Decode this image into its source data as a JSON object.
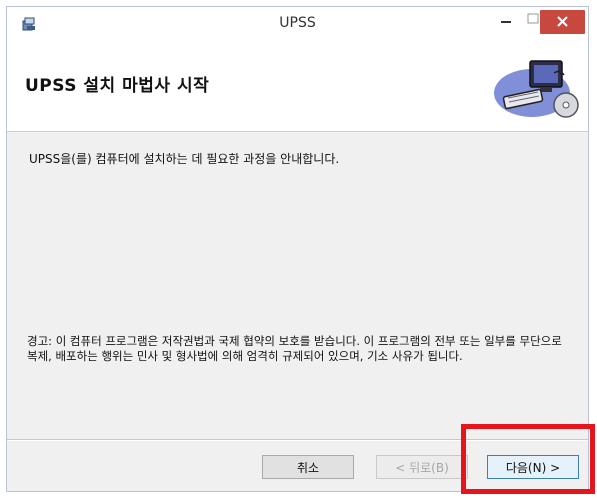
{
  "window": {
    "title": "UPSS",
    "controls": {
      "minimize": "–",
      "maximize": "□",
      "close": "✕"
    }
  },
  "header": {
    "title": "UPSS 설치 마법사 시작"
  },
  "content": {
    "description": "UPSS을(를) 컴퓨터에 설치하는 데 필요한 과정을 안내합니다.",
    "warning": "경고: 이 컴퓨터 프로그램은 저작권법과 국제 협약의 보호를 받습니다. 이 프로그램의 전부 또는 일부를 무단으로 복제, 배포하는 행위는 민사 및 형사법에 의해 엄격히 규제되어 있으며, 기소 사유가 됩니다."
  },
  "buttons": {
    "cancel": "취소",
    "back": "< 뒤로(B)",
    "next": "다음(N) >"
  },
  "colors": {
    "close_button": "#c7483e",
    "highlight": "#e8141b",
    "default_button_border": "#3c7fb1"
  }
}
